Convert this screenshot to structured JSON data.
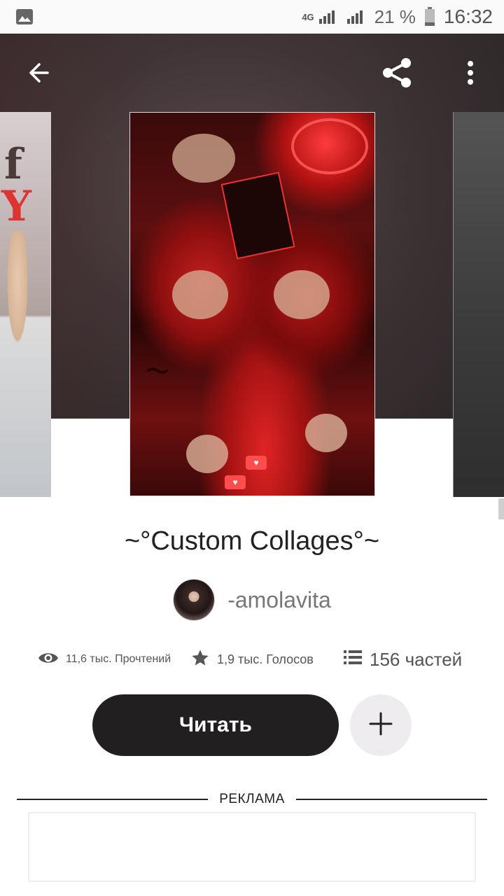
{
  "status_bar": {
    "network": "4G",
    "battery_percent": "21 %",
    "battery_level": 0.21,
    "time": "16:32",
    "icons": [
      "image-notification-icon",
      "signal-4g-icon",
      "signal-icon",
      "battery-icon"
    ]
  },
  "toolbar": {
    "back_icon": "arrow-left-icon",
    "share_icon": "share-icon",
    "more_icon": "more-vertical-icon"
  },
  "story": {
    "title": "~°Custom Collages°~",
    "author": "-amolavita",
    "reads": "11,6 тыс. Прочтений",
    "votes": "1,9 тыс. Голосов",
    "parts": "156 частей",
    "read_button": "Читать",
    "add_icon": "plus-icon"
  },
  "ad": {
    "label": "РЕКЛАМА"
  },
  "colors": {
    "primary_button": "#221f20",
    "add_button_bg": "#eeecef",
    "hero_bg": "#403436",
    "text_muted": "#777777"
  }
}
